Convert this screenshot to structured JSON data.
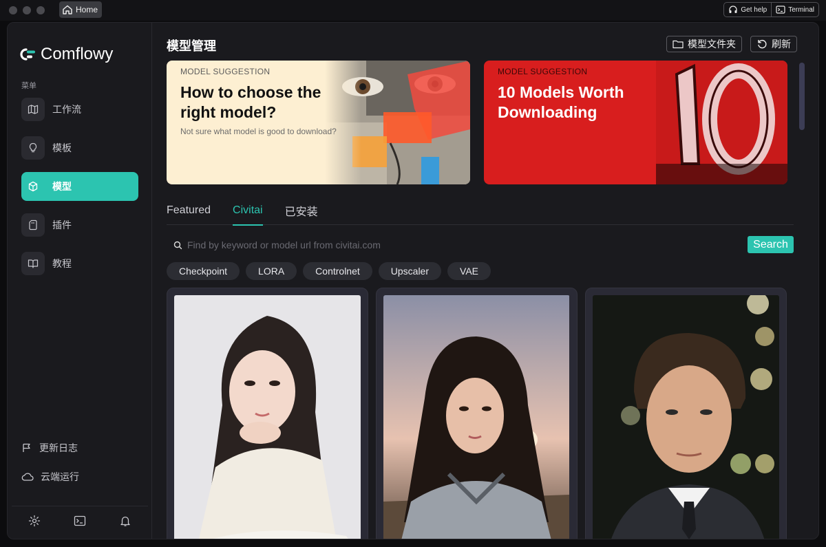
{
  "titlebar": {
    "home_tab": "Home",
    "get_help": "Get help",
    "terminal": "Terminal"
  },
  "sidebar": {
    "brand": "Comflowy",
    "menu_label": "菜单",
    "items": [
      {
        "label": "工作流",
        "icon": "map-icon"
      },
      {
        "label": "模板",
        "icon": "lightbulb-icon"
      },
      {
        "label": "模型",
        "icon": "cube-icon",
        "active": true
      },
      {
        "label": "插件",
        "icon": "sd-card-icon"
      },
      {
        "label": "教程",
        "icon": "book-icon"
      }
    ],
    "changelog": "更新日志",
    "cloud": "云端运行",
    "footer_icons": [
      "settings-icon",
      "terminal-icon",
      "bell-icon"
    ]
  },
  "header": {
    "title": "模型管理",
    "folder_button": "模型文件夹",
    "refresh_button": "刷新"
  },
  "banners": [
    {
      "tag": "MODEL SUGGESTION",
      "title": "How to choose the right model?",
      "subtitle": "Not sure what model is good to download?"
    },
    {
      "tag": "MODEL SUGGESTION",
      "title": "10 Models Worth Downloading",
      "subtitle": ""
    }
  ],
  "tabs": [
    "Featured",
    "Civitai",
    "已安装"
  ],
  "active_tab": "Civitai",
  "search": {
    "placeholder": "Find by keyword or model url from civitai.com",
    "value": "",
    "button": "Search"
  },
  "filters": [
    "Checkpoint",
    "LORA",
    "Controlnet",
    "Upscaler",
    "VAE"
  ],
  "colors": {
    "accent": "#2cc4b0",
    "background": "#1a1a1e",
    "banner1_bg": "#fdefd2",
    "banner2_bg": "#d81e1e"
  }
}
